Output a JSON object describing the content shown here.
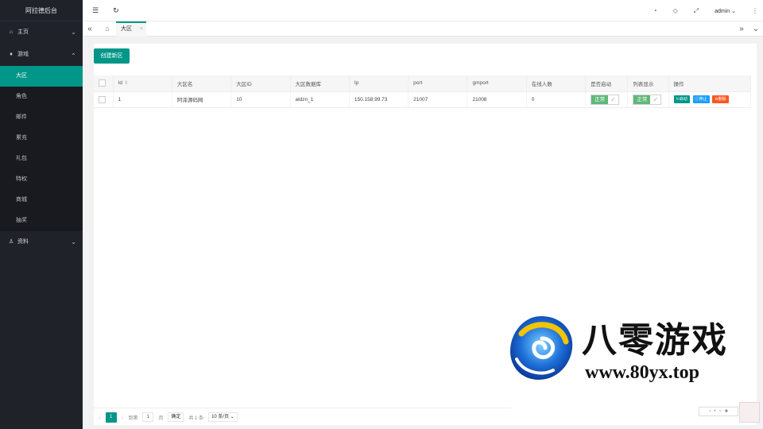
{
  "app": {
    "title": "阿拉德后台"
  },
  "sidebar": {
    "groups": [
      {
        "label": "主页"
      },
      {
        "label": "游戏"
      },
      {
        "label": "资料"
      }
    ],
    "game_items": [
      "大区",
      "角色",
      "邮件",
      "累充",
      "礼包",
      "特权",
      "商城",
      "抽奖"
    ]
  },
  "topbar": {
    "user": "admin"
  },
  "tabs": {
    "active": "大区",
    "close": "×"
  },
  "content": {
    "create_button": "创建新区",
    "columns": [
      "Id",
      "大区名",
      "大区ID",
      "大区数据库",
      "Ip",
      "port",
      "gmport",
      "在线人数",
      "是否启动",
      "列表显示",
      "操作"
    ],
    "rows": [
      {
        "id": "1",
        "name": "阿泽源码网",
        "zone_id": "10",
        "db": "aldzn_1",
        "ip": "150.158.99.73",
        "port": "21007",
        "gmport": "21008",
        "online": "0",
        "started": "正常",
        "listed": "正常"
      }
    ],
    "ops": {
      "start": "启动",
      "stop": "停止",
      "delete": "删除"
    }
  },
  "pager": {
    "current": "1",
    "goto_label": "到第",
    "page_input": "1",
    "page_suffix": "页",
    "confirm": "确定",
    "total": "共 1 条",
    "per_page": "10 条/页"
  },
  "watermark": {
    "brand": "八零游戏",
    "url": "www.80yx.top"
  },
  "icons": [
    "menu-icon",
    "refresh-icon",
    "theme-icon",
    "tag-icon",
    "fullscreen-icon",
    "more-icon"
  ],
  "colors": {
    "accent": "#009688",
    "sidebar_bg": "#20222a",
    "blue": "#1e9fff",
    "orange": "#ff5722",
    "green": "#5fb878"
  }
}
